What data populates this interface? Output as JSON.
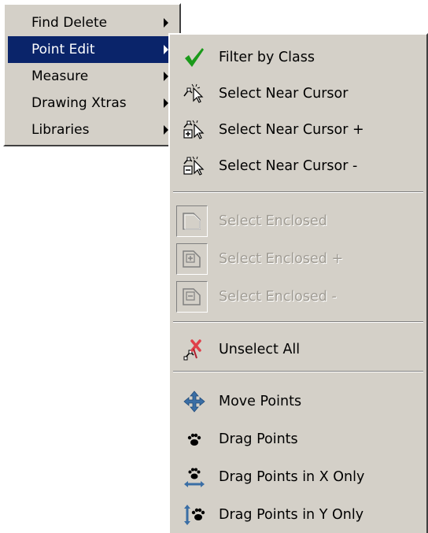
{
  "main_menu": {
    "items": [
      {
        "label": "Find Delete",
        "has_submenu": true,
        "active": false
      },
      {
        "label": "Point Edit",
        "has_submenu": true,
        "active": true
      },
      {
        "label": "Measure",
        "has_submenu": true,
        "active": false
      },
      {
        "label": "Drawing Xtras",
        "has_submenu": true,
        "active": false
      },
      {
        "label": "Libraries",
        "has_submenu": true,
        "active": false
      }
    ]
  },
  "submenu": {
    "items": [
      {
        "label": "Filter by Class",
        "icon": "checkmark-icon",
        "enabled": true
      },
      {
        "label": "Select Near Cursor",
        "icon": "select-near-cursor-icon",
        "enabled": true
      },
      {
        "label": "Select Near Cursor +",
        "icon": "select-near-cursor-plus-icon",
        "enabled": true
      },
      {
        "label": "Select Near Cursor -",
        "icon": "select-near-cursor-minus-icon",
        "enabled": true
      },
      {
        "label": "Select Enclosed",
        "icon": "select-enclosed-icon",
        "enabled": false
      },
      {
        "label": "Select Enclosed +",
        "icon": "select-enclosed-plus-icon",
        "enabled": false
      },
      {
        "label": "Select Enclosed -",
        "icon": "select-enclosed-minus-icon",
        "enabled": false
      },
      {
        "label": "Unselect All",
        "icon": "unselect-all-icon",
        "enabled": true
      },
      {
        "label": "Move Points",
        "icon": "move-points-icon",
        "enabled": true
      },
      {
        "label": "Drag Points",
        "icon": "drag-points-icon",
        "enabled": true
      },
      {
        "label": "Drag Points in X Only",
        "icon": "drag-points-x-icon",
        "enabled": true
      },
      {
        "label": "Drag Points in Y Only",
        "icon": "drag-points-y-icon",
        "enabled": true
      }
    ]
  },
  "colors": {
    "menu_bg": "#d4d0c8",
    "highlight": "#0a246a",
    "highlight_text": "#ffffff",
    "disabled_text": "#a09c94",
    "check_green": "#1a9a1a",
    "move_blue": "#3a6ea5",
    "unselect_red": "#e0404a"
  }
}
